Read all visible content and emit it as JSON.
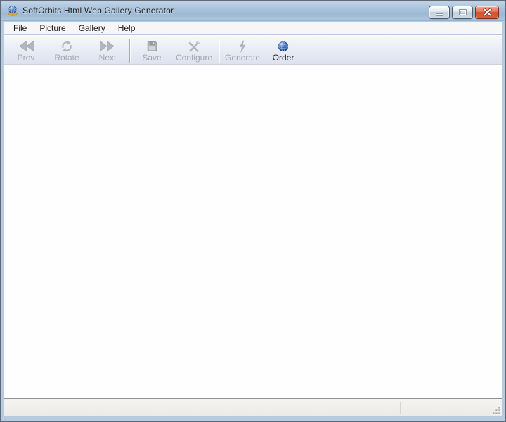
{
  "titlebar": {
    "title": "SoftOrbits Html Web Gallery Generator",
    "app_icon": "globe-gallery-icon",
    "controls": {
      "minimize_label": "minimize",
      "maximize_label": "maximize",
      "close_label": "close"
    }
  },
  "menubar": {
    "items": [
      {
        "label": "File"
      },
      {
        "label": "Picture"
      },
      {
        "label": "Gallery"
      },
      {
        "label": "Help"
      }
    ]
  },
  "toolbar": {
    "buttons": [
      {
        "label": "Prev",
        "icon": "prev-icon",
        "enabled": false
      },
      {
        "label": "Rotate",
        "icon": "rotate-icon",
        "enabled": false
      },
      {
        "label": "Next",
        "icon": "next-icon",
        "enabled": false
      },
      {
        "label": "Save",
        "icon": "save-icon",
        "enabled": false
      },
      {
        "label": "Configure",
        "icon": "configure-icon",
        "enabled": false
      },
      {
        "label": "Generate",
        "icon": "generate-icon",
        "enabled": false
      },
      {
        "label": "Order",
        "icon": "order-globe-icon",
        "enabled": true
      }
    ]
  },
  "content": {
    "text": ""
  },
  "statusbar": {
    "left_text": "",
    "right_text": ""
  },
  "colors": {
    "titlebar_gradient_top": "#c2d5e8",
    "titlebar_gradient_bottom": "#b0c8e0",
    "window_border": "#b5cbe2",
    "toolbar_bg": "#e9ecf5",
    "disabled_icon": "#b2b6be",
    "disabled_text": "#a2a6ad",
    "enabled_text": "#1b1b1b",
    "close_button_red": "#d1512f",
    "order_globe_blue": "#3f6fc0",
    "statusbar_bg": "#f0eeec"
  }
}
